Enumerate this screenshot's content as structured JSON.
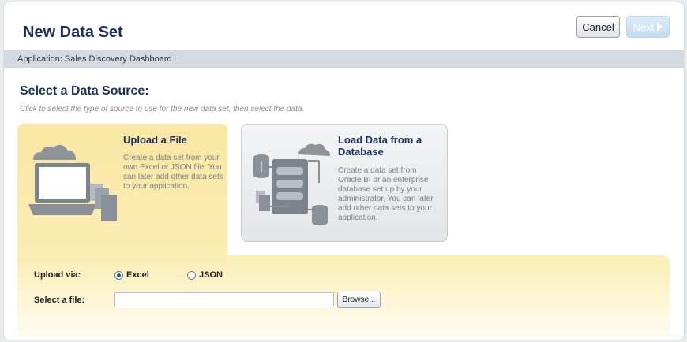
{
  "dialog": {
    "title": "New Data Set",
    "cancel_label": "Cancel",
    "next_label": "Next"
  },
  "app_bar": {
    "text": "Application: Sales Discovery Dashboard"
  },
  "source": {
    "heading": "Select a Data Source:",
    "instruction": "Click to select the type of source to use for the new data set, then select the data.",
    "tiles": [
      {
        "title": "Upload a File",
        "description": "Create a data set from your own Excel or JSON file. You can later add other data sets to your application.",
        "icon": "laptop-cloud-file-icon",
        "selected": true
      },
      {
        "title": "Load Data from a Database",
        "description": "Create a data set from Oracle BI or an enterprise database set up by your administrator. You can later add other data sets to your application.",
        "icon": "database-network-icon",
        "selected": false
      }
    ]
  },
  "upload": {
    "via_label": "Upload via:",
    "options": [
      {
        "label": "Excel",
        "checked": true
      },
      {
        "label": "JSON",
        "checked": false
      }
    ],
    "file_label": "Select a file:",
    "file_value": "",
    "browse_label": "Browse..."
  },
  "colors": {
    "title": "#1c2e5e",
    "selected_tile": "#fbecb5",
    "app_bar": "#d3dae3"
  }
}
